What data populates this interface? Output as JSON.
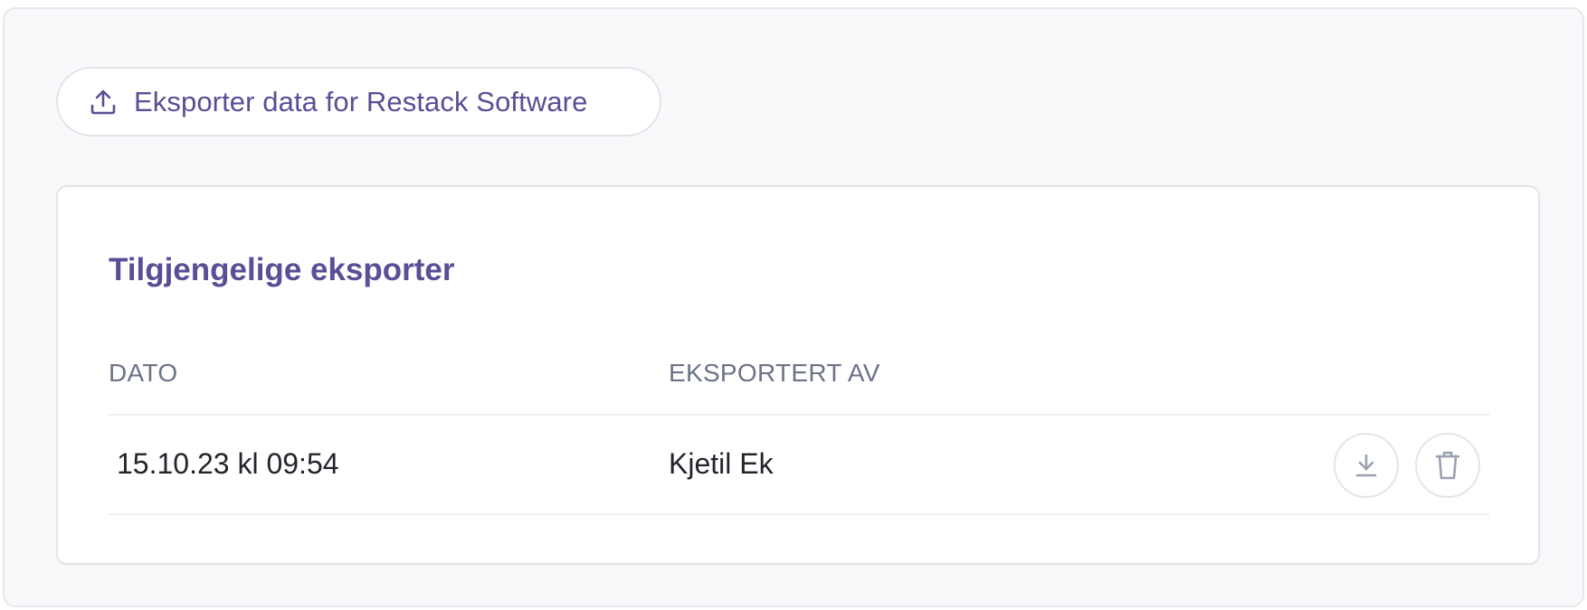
{
  "export_button": {
    "label": "Eksporter data for Restack Software",
    "icon": "upload-icon"
  },
  "exports_card": {
    "title": "Tilgjengelige eksporter",
    "columns": {
      "date": "DATO",
      "exported_by": "EKSPORTERT AV"
    },
    "rows": [
      {
        "date": "15.10.23 kl 09:54",
        "exported_by": "Kjetil Ek",
        "actions": [
          "download-icon",
          "trash-icon"
        ]
      }
    ]
  },
  "colors": {
    "accent": "#5a4e96",
    "header_text": "#6b7386",
    "body_text": "#23252c",
    "icon": "#9aa1b1"
  }
}
